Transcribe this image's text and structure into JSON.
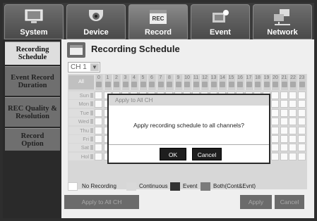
{
  "tabs": [
    {
      "label": "System",
      "icon": "monitor-icon",
      "active": false
    },
    {
      "label": "Device",
      "icon": "camera-icon",
      "active": false
    },
    {
      "label": "Record",
      "icon": "record-icon",
      "active": true
    },
    {
      "label": "Event",
      "icon": "event-icon",
      "active": false
    },
    {
      "label": "Network",
      "icon": "network-icon",
      "active": false
    }
  ],
  "record_icon_text": "REC",
  "sidebar": {
    "items": [
      {
        "label": "Recording Schedule",
        "active": true
      },
      {
        "label": "Event Record Duration",
        "active": false
      },
      {
        "label": "REC Quality & Resolution",
        "active": false
      },
      {
        "label": "Record Option",
        "active": false
      }
    ]
  },
  "page": {
    "title": "Recording Schedule",
    "channel": "CH 1",
    "all_label": "All",
    "hours": [
      "0",
      "1",
      "2",
      "3",
      "4",
      "5",
      "6",
      "7",
      "8",
      "9",
      "10",
      "11",
      "12",
      "13",
      "14",
      "15",
      "16",
      "17",
      "18",
      "19",
      "20",
      "21",
      "22",
      "23"
    ],
    "days": [
      "Sun",
      "Mon",
      "Tue",
      "Wed",
      "Thu",
      "Fri",
      "Sat",
      "Hol"
    ]
  },
  "legend": [
    {
      "label": "No Recording",
      "color": "#ffffff"
    },
    {
      "label": "Continuous",
      "color": "#d9d9d9"
    },
    {
      "label": "Event",
      "color": "#333333"
    },
    {
      "label": "Both(Cont&Evnt)",
      "color": "#7a7a7a"
    }
  ],
  "buttons": {
    "apply_all": "Apply to All CH",
    "apply": "Apply",
    "cancel": "Cancel"
  },
  "dialog": {
    "title": "Apply to All CH",
    "message": "Apply recording schedule to all channels?",
    "ok": "OK",
    "cancel": "Cancel"
  }
}
